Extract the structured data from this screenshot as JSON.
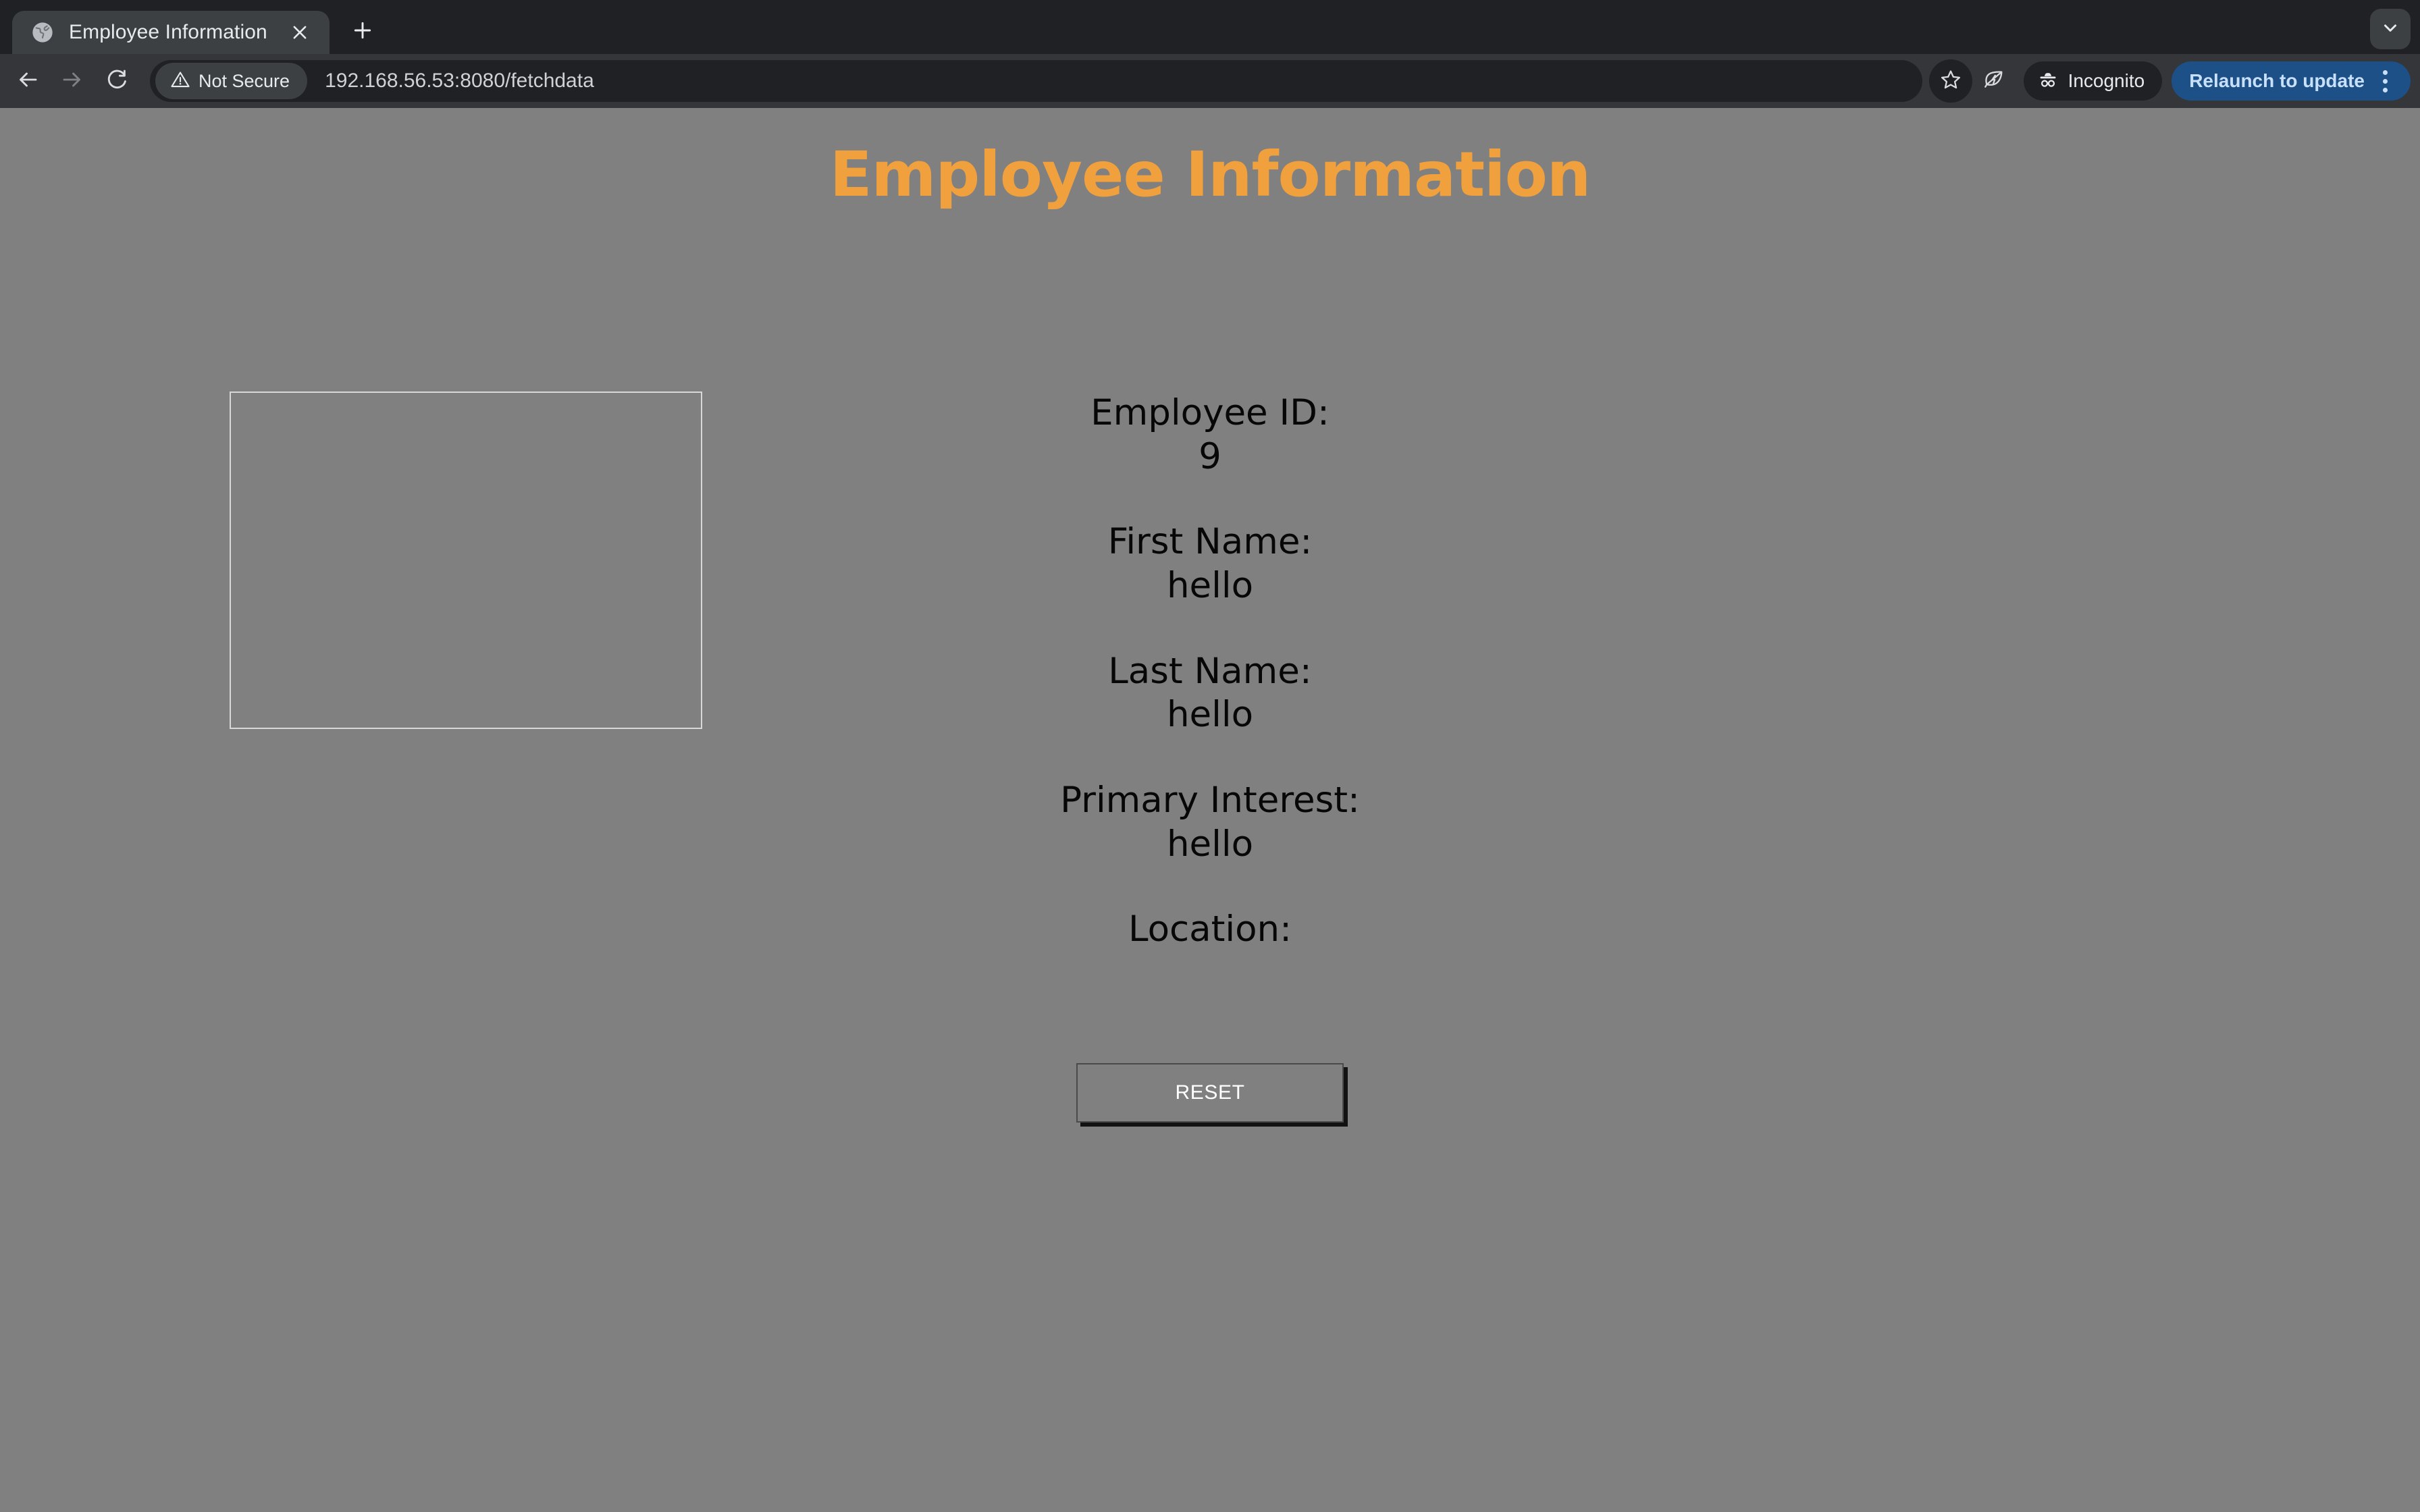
{
  "browser": {
    "tab": {
      "title": "Employee Information",
      "favicon_icon": "globe-icon",
      "close_icon": "close-icon"
    },
    "new_tab_icon": "plus-icon",
    "tab_search_icon": "chevron-down-icon",
    "toolbar": {
      "back_icon": "back-arrow-icon",
      "forward_icon": "forward-arrow-icon",
      "reload_icon": "reload-icon",
      "security_icon": "warning-triangle-icon",
      "security_label": "Not Secure",
      "url": "192.168.56.53:8080/fetchdata",
      "bookmark_icon": "star-icon",
      "energy_saver_icon": "leaf-bolt-icon",
      "incognito_icon": "incognito-hat-icon",
      "incognito_label": "Incognito",
      "relaunch_label": "Relaunch to update",
      "menu_icon": "kebab-menu-icon"
    }
  },
  "page": {
    "heading": "Employee Information",
    "fields": [
      {
        "label": "Employee ID:",
        "value": "9"
      },
      {
        "label": "First Name:",
        "value": "hello"
      },
      {
        "label": "Last Name:",
        "value": "hello"
      },
      {
        "label": "Primary Interest:",
        "value": "hello"
      },
      {
        "label": "Location:",
        "value": ""
      }
    ],
    "reset_label": "RESET",
    "colors": {
      "background": "#808080",
      "heading": "#f0a03c",
      "text": "#070707",
      "reset_text": "#ffffff",
      "accent_blue": "#1c5087"
    }
  }
}
